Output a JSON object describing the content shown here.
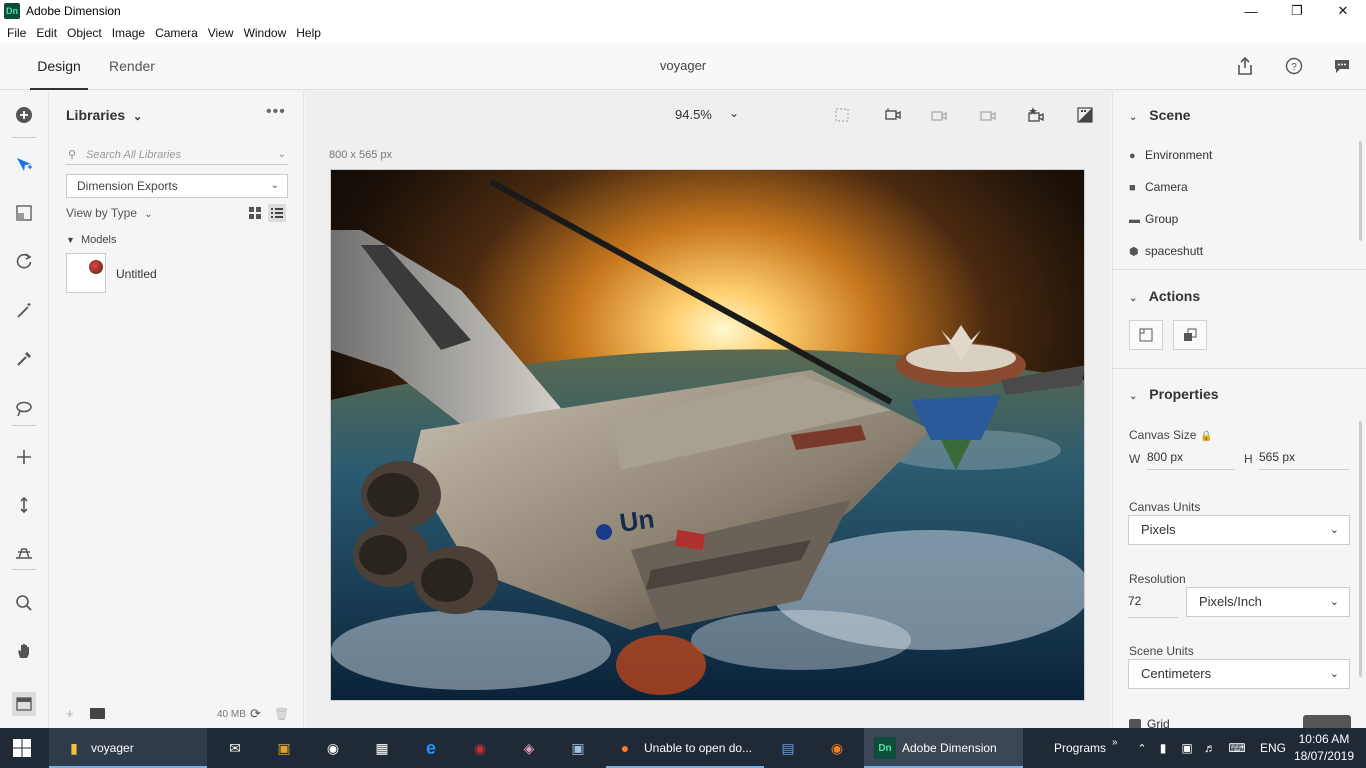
{
  "window": {
    "title": "Adobe Dimension",
    "logo_text": "Dn",
    "minimize": "—",
    "maximize": "❐",
    "close": "✕"
  },
  "menu": [
    "File",
    "Edit",
    "Object",
    "Image",
    "Camera",
    "View",
    "Window",
    "Help"
  ],
  "topbar": {
    "tab_design": "Design",
    "tab_render": "Render",
    "doc_title": "voyager"
  },
  "libraries": {
    "title": "Libraries",
    "search_placeholder": "Search All Libraries",
    "selected_library": "Dimension Exports",
    "view_by": "View by Type",
    "section": "Models",
    "items": [
      {
        "name": "Untitled"
      }
    ],
    "storage": "40 MB"
  },
  "canvas": {
    "zoom": "94.5%",
    "size_label": "800 x 565 px"
  },
  "scene": {
    "title": "Scene",
    "items": [
      {
        "label": "Environment",
        "icon": "globe-icon"
      },
      {
        "label": "Camera",
        "icon": "camera-icon"
      },
      {
        "label": "Group",
        "icon": "folder-icon"
      },
      {
        "label": "spaceshutt",
        "icon": "model-icon"
      }
    ]
  },
  "actions": {
    "title": "Actions"
  },
  "properties": {
    "title": "Properties",
    "canvas_size_label": "Canvas Size",
    "w_label": "W",
    "w_value": "800 px",
    "h_label": "H",
    "h_value": "565 px",
    "canvas_units_label": "Canvas Units",
    "canvas_units_value": "Pixels",
    "resolution_label": "Resolution",
    "resolution_value": "72",
    "resolution_unit": "Pixels/Inch",
    "scene_units_label": "Scene Units",
    "scene_units_value": "Centimeters",
    "grid_label": "Grid"
  },
  "taskbar": {
    "folder_label": "voyager",
    "firefox_label": "Unable to open do...",
    "dimension_label": "Adobe Dimension",
    "programs_label": "Programs",
    "lang": "ENG",
    "time": "10:06 AM",
    "date": "18/07/2019"
  },
  "colors": {
    "accent": "#1473e6",
    "taskbar": "#1f2a36"
  }
}
